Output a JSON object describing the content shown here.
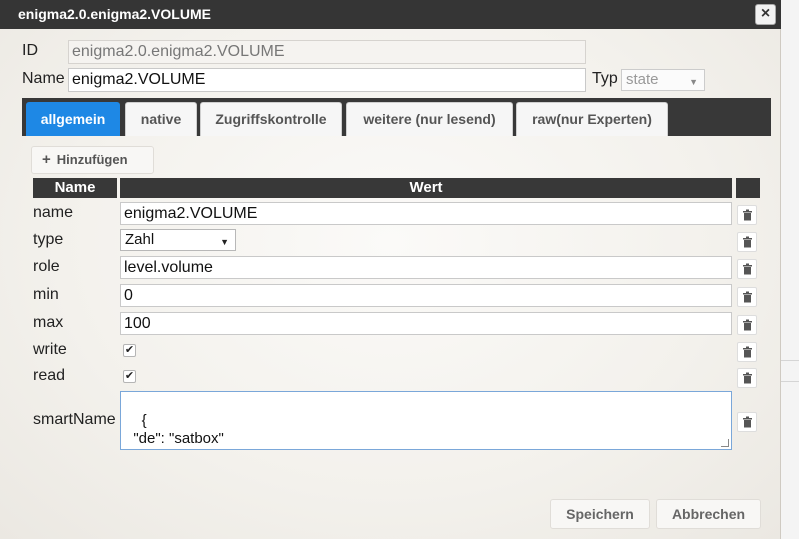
{
  "dialog": {
    "title": "enigma2.0.enigma2.VOLUME",
    "close_label": "×"
  },
  "form": {
    "id_label": "ID",
    "id_value": "enigma2.0.enigma2.VOLUME",
    "name_label": "Name",
    "name_value": "enigma2.VOLUME",
    "typ_label": "Typ",
    "typ_value": "state"
  },
  "tabs": [
    {
      "label": "allgemein",
      "active": true
    },
    {
      "label": "native"
    },
    {
      "label": "Zugriffskontrolle"
    },
    {
      "label": "weitere (nur lesend)"
    },
    {
      "label": "raw(nur Experten)"
    }
  ],
  "add_button": {
    "icon": "plus-icon",
    "label": "Hinzufügen"
  },
  "table": {
    "headers": [
      "Name",
      "Wert"
    ],
    "rows": [
      {
        "name": "name",
        "kind": "text",
        "value": "enigma2.VOLUME"
      },
      {
        "name": "type",
        "kind": "select",
        "value": "Zahl"
      },
      {
        "name": "role",
        "kind": "text",
        "value": "level.volume"
      },
      {
        "name": "min",
        "kind": "text",
        "value": "0"
      },
      {
        "name": "max",
        "kind": "text",
        "value": "100"
      },
      {
        "name": "write",
        "kind": "checkbox",
        "checked": true
      },
      {
        "name": "read",
        "kind": "checkbox",
        "checked": true
      },
      {
        "name": "smartName",
        "kind": "textarea",
        "value": "{\n  \"de\": \"satbox\"\n}"
      }
    ],
    "row_action_icon": "trash-icon"
  },
  "footer": {
    "save_label": "Speichern",
    "cancel_label": "Abbrechen"
  },
  "colors": {
    "titlebar": "#353535",
    "active_tab": "#1e88e5",
    "header": "#383838"
  }
}
